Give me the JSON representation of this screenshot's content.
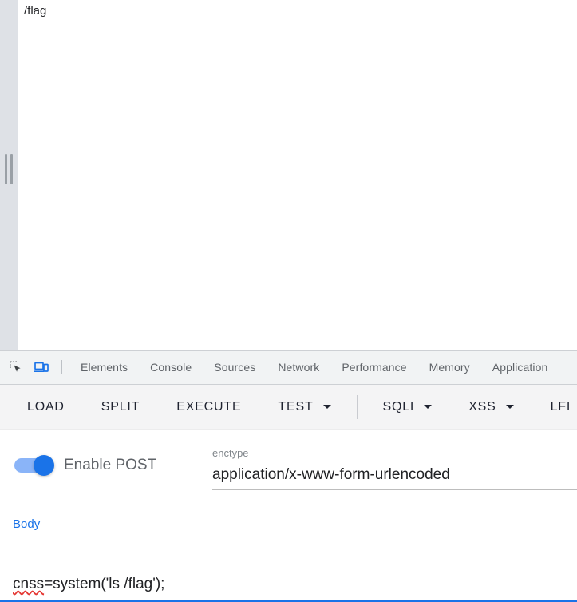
{
  "viewport": {
    "page_text": "/flag",
    "resize_handle_icon": "vertical-grip-handle"
  },
  "devtools": {
    "inspect_icon": "inspect-element-icon",
    "device_toolbar_icon": "device-toolbar-icon",
    "device_toolbar_active": true,
    "accent_color": "#1a73e8",
    "tabs": [
      {
        "label": "Elements",
        "active": false
      },
      {
        "label": "Console",
        "active": false
      },
      {
        "label": "Sources",
        "active": false
      },
      {
        "label": "Network",
        "active": false
      },
      {
        "label": "Performance",
        "active": false
      },
      {
        "label": "Memory",
        "active": false
      },
      {
        "label": "Application",
        "active": false
      }
    ]
  },
  "app_toolbar": {
    "buttons": [
      {
        "label": "LOAD",
        "caret": false,
        "divider_after": false
      },
      {
        "label": "SPLIT",
        "caret": false,
        "divider_after": false
      },
      {
        "label": "EXECUTE",
        "caret": false,
        "divider_after": false
      },
      {
        "label": "TEST",
        "caret": true,
        "divider_after": true
      },
      {
        "label": "SQLI",
        "caret": true,
        "divider_after": false
      },
      {
        "label": "XSS",
        "caret": true,
        "divider_after": false
      },
      {
        "label": "LFI",
        "caret": false,
        "divider_after": false
      }
    ]
  },
  "form": {
    "post_toggle": {
      "label": "Enable POST",
      "state": "on",
      "track_color": "#8ab4f8",
      "thumb_color": "#1a73e8"
    },
    "enctype": {
      "label": "enctype",
      "value": "application/x-www-form-urlencoded"
    },
    "body": {
      "label": "Body",
      "value_prefix": "cnss",
      "value_rest": "=system('ls /flag');",
      "focused": true,
      "underline_color": "#1a73e8"
    }
  }
}
